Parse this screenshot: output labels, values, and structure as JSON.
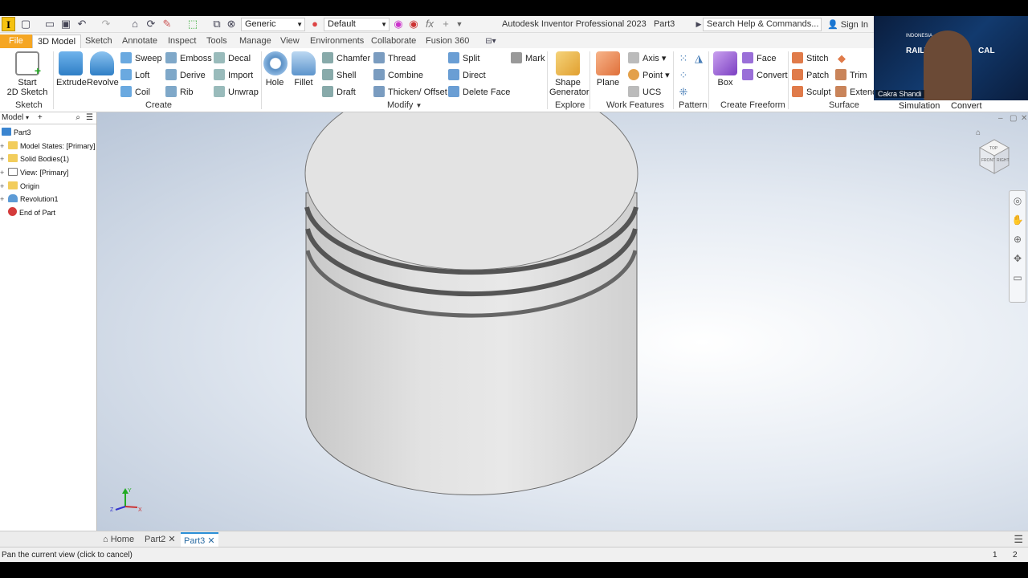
{
  "app": {
    "logo_letter": "I",
    "title": "Autodesk Inventor Professional 2023",
    "document": "Part3",
    "search_placeholder": "Search Help & Commands...",
    "sign_in": "Sign In",
    "material_combo": "Generic",
    "appearance_combo": "Default"
  },
  "tabs": [
    "File",
    "3D Model",
    "Sketch",
    "Annotate",
    "Inspect",
    "Tools",
    "Manage",
    "View",
    "Environments",
    "Collaborate",
    "Fusion 360"
  ],
  "ribbon": {
    "sketch": {
      "start_line1": "Start",
      "start_line2": "2D Sketch",
      "panel": "Sketch"
    },
    "create": {
      "extrude": "Extrude",
      "revolve": "Revolve",
      "sweep": "Sweep",
      "loft": "Loft",
      "coil": "Coil",
      "emboss": "Emboss",
      "derive": "Derive",
      "rib": "Rib",
      "decal": "Decal",
      "import": "Import",
      "unwrap": "Unwrap",
      "panel": "Create"
    },
    "modify": {
      "hole": "Hole",
      "fillet": "Fillet",
      "chamfer": "Chamfer",
      "shell": "Shell",
      "draft": "Draft",
      "thread": "Thread",
      "combine": "Combine",
      "thicken": "Thicken/ Offset",
      "split": "Split",
      "direct": "Direct",
      "delete_face": "Delete Face",
      "mark": "Mark",
      "panel": "Modify"
    },
    "explore": {
      "shape_line1": "Shape",
      "shape_line2": "Generator",
      "panel": "Explore"
    },
    "work_features": {
      "plane": "Plane",
      "axis": "Axis",
      "point": "Point",
      "ucs": "UCS",
      "panel": "Work Features"
    },
    "pattern": {
      "panel": "Pattern"
    },
    "freeform": {
      "box": "Box",
      "face": "Face",
      "convert": "Convert",
      "panel": "Create Freeform"
    },
    "surface": {
      "stitch": "Stitch",
      "patch": "Patch",
      "sculpt": "Sculpt",
      "trim": "Trim",
      "extend": "Extend",
      "panel": "Surface"
    },
    "simulation": {
      "panel": "Simulation"
    },
    "convert": {
      "panel": "Convert"
    }
  },
  "webcam": {
    "name": "Cakra Shandi",
    "banner_left": "RAILWA",
    "banner_right": "CAL",
    "banner_mid": "E",
    "small": "INDONESIA"
  },
  "browser": {
    "title": "Model",
    "items": [
      {
        "label": "Part3",
        "icon": "part-icon"
      },
      {
        "label": "Model States: [Primary]",
        "icon": "folder-icon"
      },
      {
        "label": "Solid Bodies(1)",
        "icon": "folder-icon"
      },
      {
        "label": "View: [Primary]",
        "icon": "view-icon"
      },
      {
        "label": "Origin",
        "icon": "folder-icon"
      },
      {
        "label": "Revolution1",
        "icon": "revolve-icon"
      },
      {
        "label": "End of Part",
        "icon": "end-icon"
      }
    ]
  },
  "document_tabs": [
    {
      "label": "Home"
    },
    {
      "label": "Part2"
    },
    {
      "label": "Part3",
      "active": true
    }
  ],
  "status": {
    "message": "Pan the current view (click to cancel)",
    "count1": "1",
    "count2": "2"
  },
  "viewcube": {
    "front": "FRONT",
    "right": "RIGHT",
    "top": "TOP"
  },
  "axes": {
    "x": "X",
    "y": "Y",
    "z": "Z"
  },
  "colors": {
    "accent": "#2b8fd6",
    "file_tab": "#f5a623"
  }
}
